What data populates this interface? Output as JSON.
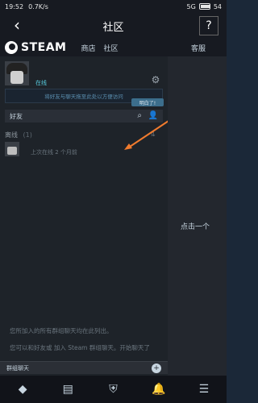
{
  "statusbar": {
    "time": "19:52",
    "speed": "0.7K/s",
    "signal": "5G",
    "battery": "54"
  },
  "navbar": {
    "title": "社区",
    "back_icon": "back-arrow-icon",
    "help_label": "?"
  },
  "steam": {
    "logo_text": "STEAM",
    "nav": [
      "商店",
      "社区"
    ],
    "support": "客服"
  },
  "profile": {
    "status": "在线",
    "drag_hint": "将好友与聊天拖至此处以方便访问",
    "got_it": "明白了!"
  },
  "friends": {
    "label": "好友",
    "offline_label": "离线",
    "offline_count": "(1)",
    "last_online": "上次在线 2 个月前"
  },
  "group": {
    "label": "群组聊天",
    "text1": "您所加入的所有群组聊天均在此列出。",
    "text2": "您可以和好友或 加入 Steam 群组聊天。开始聊天了"
  },
  "right": {
    "hint": "点击一个"
  },
  "bottom_nav": [
    "tag-icon",
    "news-icon",
    "shield-icon",
    "bell-icon",
    "menu-icon"
  ],
  "colors": {
    "accent": "#57cbde",
    "arrow": "#f07b2e",
    "background": "#1b2838"
  }
}
